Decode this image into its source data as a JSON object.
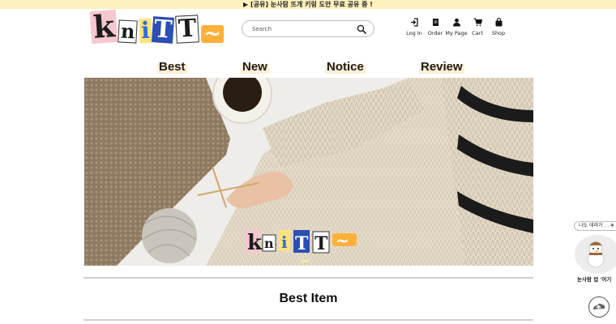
{
  "banner": {
    "text": "▶ [공유] 눈사람 뜨개 키링 도안 무료 공유 중 !"
  },
  "logo": {
    "letters": [
      {
        "char": "k",
        "bg": "#f6c7cf",
        "fg": "#1c1c1c"
      },
      {
        "char": "n",
        "bg": "#ffffff",
        "fg": "#1c1c1c"
      },
      {
        "char": "i",
        "bg": "#ffe27a",
        "fg": "#2f6fd6"
      },
      {
        "char": "T",
        "bg": "#2b4fb3",
        "fg": "#ffffff"
      },
      {
        "char": "T",
        "bg": "#ffffff",
        "fg": "#1c1c1c"
      },
      {
        "char": "~",
        "bg": "#ffb03a",
        "fg": "#ffffff"
      }
    ]
  },
  "search": {
    "placeholder": "Search"
  },
  "utilities": [
    {
      "label": "Log In",
      "icon": "login-icon"
    },
    {
      "label": "Order",
      "icon": "order-icon"
    },
    {
      "label": "My Page",
      "icon": "user-icon"
    },
    {
      "label": "Cart",
      "icon": "cart-icon"
    },
    {
      "label": "Shop",
      "icon": "shop-bag-icon"
    }
  ],
  "nav": [
    {
      "label": "Best"
    },
    {
      "label": "New"
    },
    {
      "label": "Notice"
    },
    {
      "label": "Review"
    }
  ],
  "hero": {
    "overlay_logo": "knitT~"
  },
  "sections": {
    "best_title": "Best Item"
  },
  "side_widget": {
    "bubble_text": "나도 데려가 . . ❄",
    "pill_text": "눈사람 업 '어기"
  },
  "colors": {
    "banner_bg": "#fdf1bd",
    "nav_highlight": "#fdeed4",
    "divider": "#cfcfcf"
  }
}
